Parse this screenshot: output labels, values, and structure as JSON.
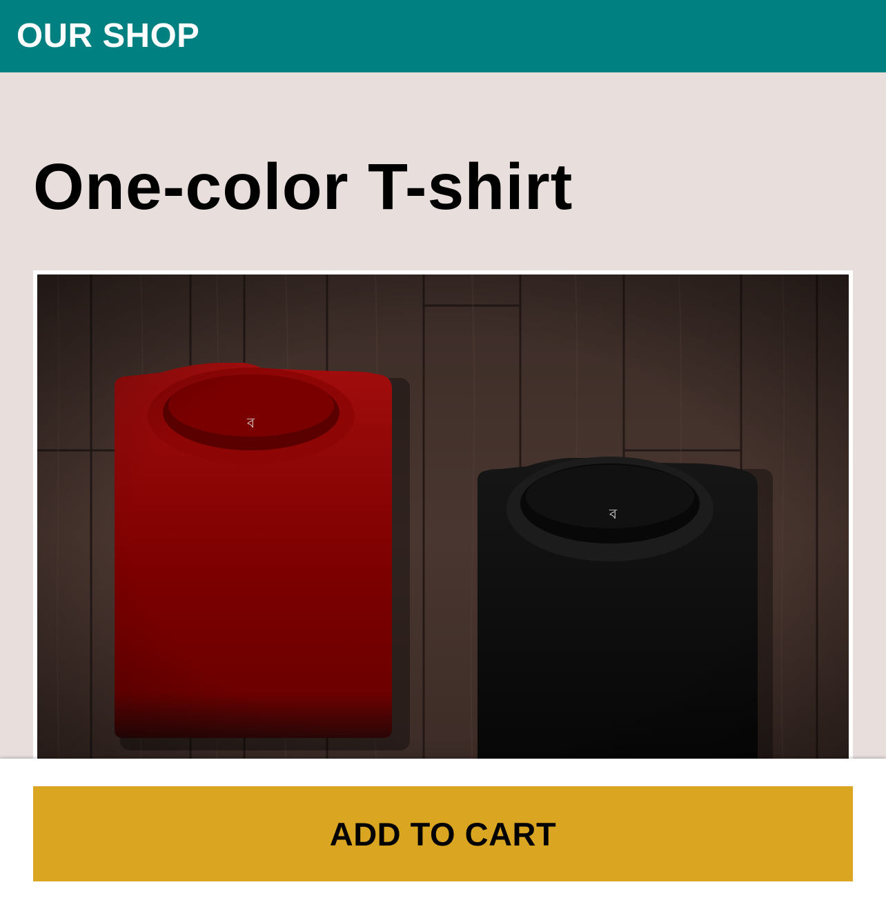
{
  "header": {
    "title": "OUR SHOP",
    "background_color": "#008080"
  },
  "product": {
    "title": "One-color T-shirt",
    "image": {
      "description": "two folded t-shirts on dark wooden planks",
      "shirt_colors": [
        "#7a0000",
        "#0a0a0a"
      ]
    }
  },
  "actions": {
    "add_to_cart_label": "ADD TO CART",
    "button_color": "#daa520"
  }
}
